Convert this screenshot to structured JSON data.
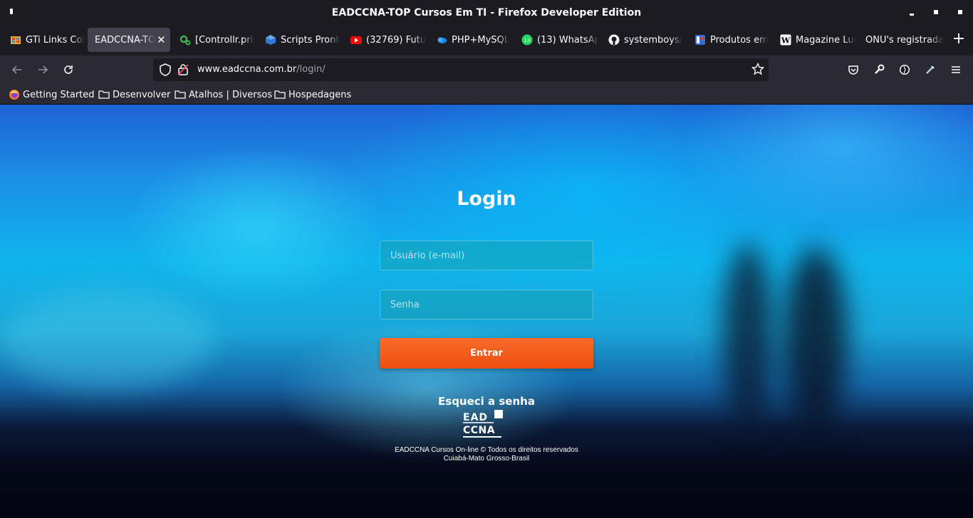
{
  "window": {
    "title": "EADCCNA-TOP Cursos Em TI - Firefox Developer Edition"
  },
  "tabs": [
    {
      "label": "GTi Links Col",
      "icon": "folder-grid-icon",
      "active": false
    },
    {
      "label": "EADCCNA-TOP",
      "icon": "none",
      "active": true
    },
    {
      "label": "[Controllr.pris",
      "icon": "gear-green-icon",
      "active": false
    },
    {
      "label": "Scripts Pront",
      "icon": "cube-icon",
      "active": false
    },
    {
      "label": "(32769) Futu",
      "icon": "youtube-icon",
      "active": false
    },
    {
      "label": "PHP+MySQL",
      "icon": "cloud-icon",
      "active": false
    },
    {
      "label": "(13) WhatsAp",
      "icon": "whatsapp-icon",
      "active": false
    },
    {
      "label": "systemboys/",
      "icon": "github-icon",
      "active": false
    },
    {
      "label": "Produtos em",
      "icon": "store-icon",
      "active": false
    },
    {
      "label": "Magazine Lui",
      "icon": "wikipedia-icon",
      "active": false
    },
    {
      "label": "ONU's registrada",
      "icon": "none",
      "active": false
    }
  ],
  "navbar": {
    "url_host": "www.eadccna.com.br",
    "url_path": "/login/"
  },
  "bookmarks": [
    {
      "label": "Getting Started",
      "icon": "firefox-icon"
    },
    {
      "label": "Desenvolver",
      "icon": "folder-icon"
    },
    {
      "label": "Atalhos | Diversos",
      "icon": "folder-icon"
    },
    {
      "label": "Hospedagens",
      "icon": "folder-icon"
    }
  ],
  "page": {
    "title": "Login",
    "username_placeholder": "Usuário (e-mail)",
    "password_placeholder": "Senha",
    "submit_label": "Entrar",
    "forgot_label": "Esqueci a senha",
    "logo_text_top": "EAD",
    "logo_text_bottom": "CCNA",
    "footer_line1": "EADCCNA Cursos On-line © Todos os direitos reservados",
    "footer_line2": "Cuiabá-Mato Grosso-Brasil"
  },
  "colors": {
    "accent_button": "#f05a1a",
    "chrome_dark": "#1c1b22",
    "chrome_toolbar": "#2b2a33"
  }
}
